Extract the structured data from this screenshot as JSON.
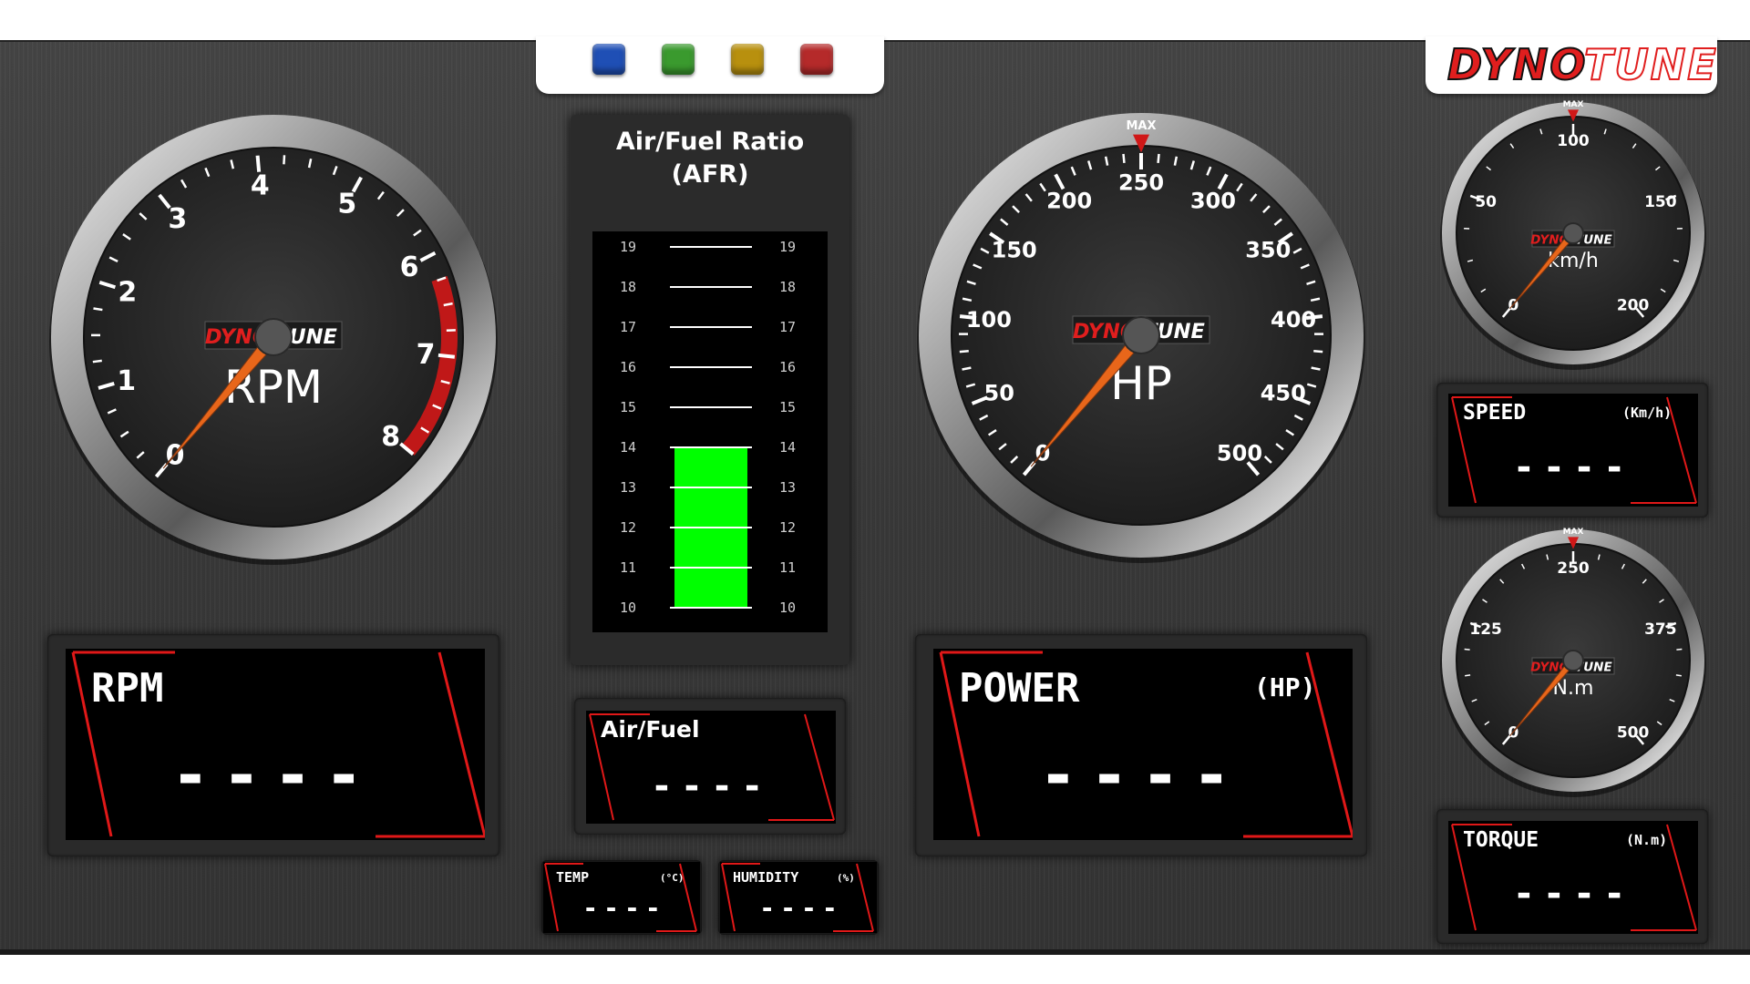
{
  "logo": {
    "part1": "DYNO",
    "part2": "TUNE",
    "colors": {
      "red": "#e01e1e",
      "black": "#111111"
    }
  },
  "mini_logo": {
    "part1": "DYNO",
    "part2": "TUNE"
  },
  "buttons": [
    {
      "name": "blue",
      "color": "#1f4fb5"
    },
    {
      "name": "green",
      "color": "#3a9a2e"
    },
    {
      "name": "yellow",
      "color": "#b8900e"
    },
    {
      "name": "red",
      "color": "#b52a2a"
    }
  ],
  "rpm_gauge": {
    "label": "RPM",
    "ticks": [
      "0",
      "1",
      "2",
      "3",
      "4",
      "5",
      "6",
      "7",
      "8"
    ]
  },
  "hp_gauge": {
    "label": "HP",
    "max_label": "MAX",
    "ticks": [
      "0",
      "50",
      "100",
      "150",
      "200",
      "250",
      "300",
      "350",
      "400",
      "450",
      "500"
    ]
  },
  "speed_gauge": {
    "label": "km/h",
    "max_label": "MAX",
    "ticks": [
      "0",
      "50",
      "100",
      "150",
      "200"
    ]
  },
  "torque_gauge": {
    "label": "N.m",
    "max_label": "MAX",
    "ticks": [
      "0",
      "125",
      "250",
      "375",
      "500"
    ]
  },
  "afr": {
    "title_line1": "Air/Fuel Ratio",
    "title_line2": "(AFR)",
    "scale": [
      "19",
      "18",
      "17",
      "16",
      "15",
      "14",
      "13",
      "12",
      "11",
      "10"
    ],
    "bar_range": [
      10,
      14
    ],
    "bar_color": "#00ff00"
  },
  "displays": {
    "rpm": {
      "label": "RPM",
      "unit": "",
      "value": "----"
    },
    "airfuel": {
      "label": "Air/Fuel",
      "unit": "",
      "value": "----"
    },
    "power": {
      "label": "POWER",
      "unit": "(HP)",
      "value": "----"
    },
    "speed": {
      "label": "SPEED",
      "unit": "(Km/h)",
      "value": "----"
    },
    "torque": {
      "label": "TORQUE",
      "unit": "(N.m)",
      "value": "----"
    },
    "temp": {
      "label": "TEMP",
      "unit": "(°C)",
      "value": "----"
    },
    "humidity": {
      "label": "HUMIDITY",
      "unit": "(%)",
      "value": "----"
    }
  },
  "needle_color": "#e8661a",
  "redline_color": "#c01818"
}
